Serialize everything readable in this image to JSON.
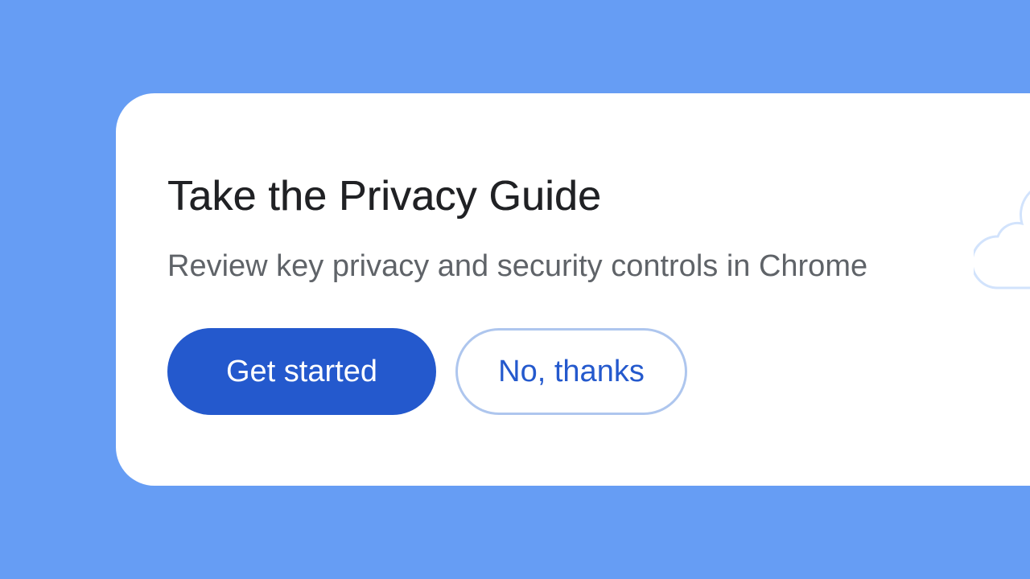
{
  "card": {
    "title": "Take the Privacy Guide",
    "subtitle": "Review key privacy and security controls in Chrome"
  },
  "actions": {
    "primary_label": "Get started",
    "secondary_label": "No, thanks"
  },
  "colors": {
    "background": "#669df4",
    "card": "#ffffff",
    "title_text": "#202124",
    "subtitle_text": "#5f6368",
    "primary_button": "#2459cd",
    "primary_button_text": "#ffffff",
    "secondary_button_border": "#aec6ee",
    "secondary_button_text": "#2459cd",
    "illustration_stroke": "#d2e3fc"
  },
  "icons": {
    "illustration": "cloud-icon"
  }
}
